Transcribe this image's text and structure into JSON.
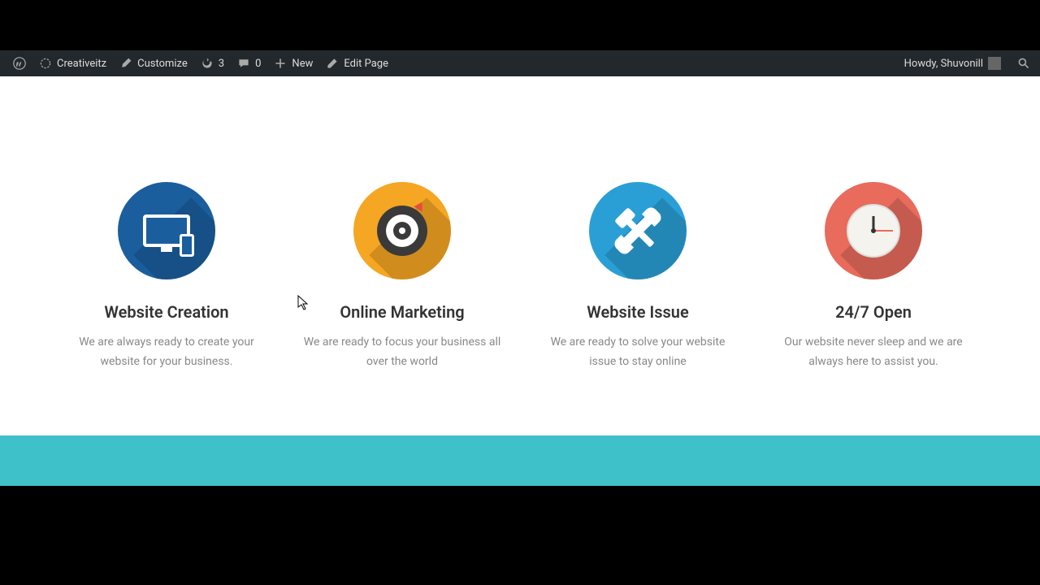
{
  "adminbar": {
    "site_name": "Creativeitz",
    "customize": "Customize",
    "updates_count": "3",
    "comments_count": "0",
    "new_label": "New",
    "edit_page": "Edit Page",
    "greeting": "Howdy, Shuvonill"
  },
  "features": [
    {
      "title": "Website Creation",
      "desc": "We are always ready to create your website for your business.",
      "icon": "monitor-icon",
      "color": "#1a5e9e"
    },
    {
      "title": "Online Marketing",
      "desc": "We are ready to focus your business all over the world",
      "icon": "target-icon",
      "color": "#f5a623"
    },
    {
      "title": "Website Issue",
      "desc": "We are ready to solve your website issue to stay online",
      "icon": "tools-icon",
      "color": "#2a9fd6"
    },
    {
      "title": "24/7 Open",
      "desc": "Our website never sleep and we are always here to assist you.",
      "icon": "clock-icon",
      "color": "#e86b5c"
    }
  ],
  "colors": {
    "teal_strip": "#3fc1c9",
    "adminbar_bg": "#23282d"
  }
}
